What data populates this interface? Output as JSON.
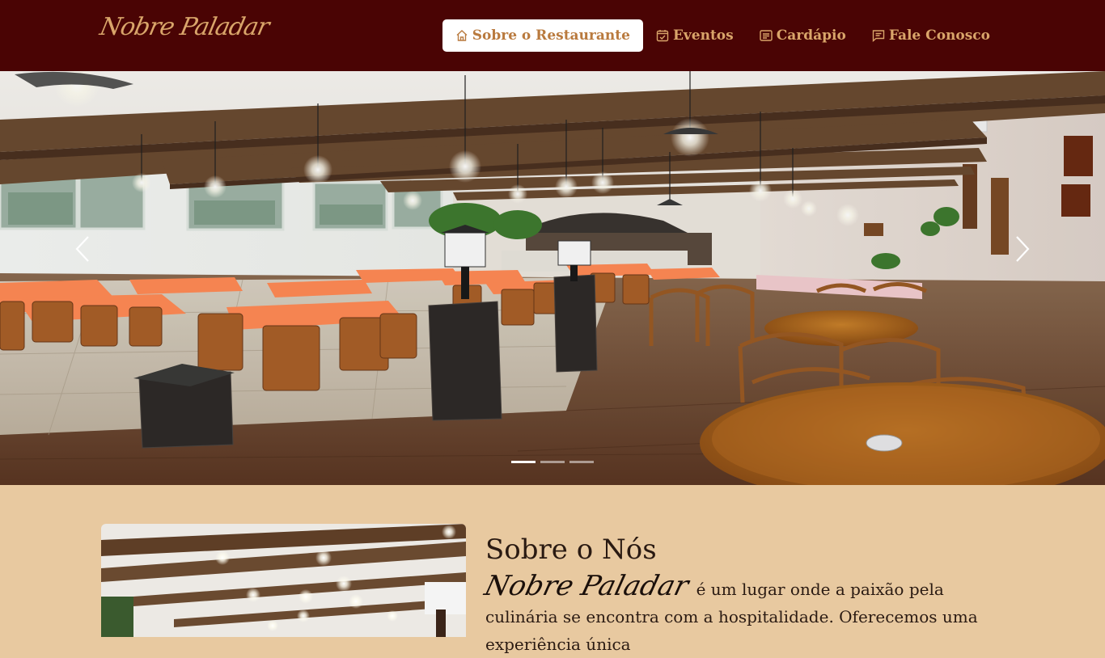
{
  "brand": {
    "logo_text": "Nobre Paladar"
  },
  "nav": {
    "items": [
      {
        "label": "Sobre o Restaurante",
        "icon": "home-icon",
        "active": true
      },
      {
        "label": "Eventos",
        "icon": "calendar-check-icon",
        "active": false
      },
      {
        "label": "Cardápio",
        "icon": "menu-list-icon",
        "active": false
      },
      {
        "label": "Fale Conosco",
        "icon": "chat-icon",
        "active": false
      }
    ]
  },
  "carousel": {
    "slide_count": 3,
    "active_index": 0,
    "prev_icon": "chevron-left-icon",
    "next_icon": "chevron-right-icon"
  },
  "about": {
    "title": "Sobre o Nós",
    "brand_name": "Nobre Paladar",
    "text": "é um lugar onde a paixão pela culinária se encontra com a hospitalidade. Oferecemos uma experiência única"
  },
  "colors": {
    "navbar_bg": "#4a0404",
    "accent": "#d9a56a",
    "page_bg": "#e8c9a0",
    "table_cloth": "#ff8a55"
  }
}
